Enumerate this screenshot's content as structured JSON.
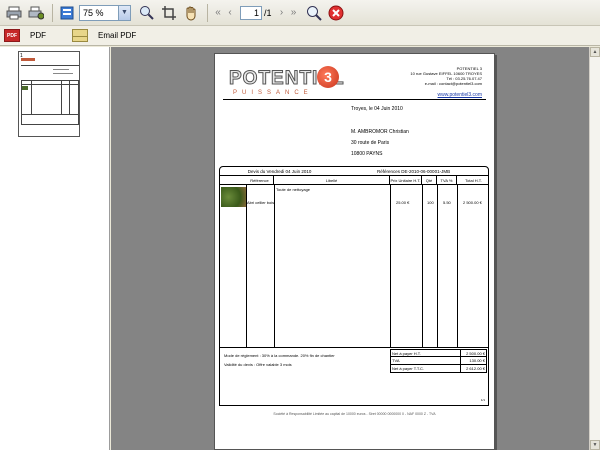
{
  "toolbar": {
    "zoom_value": "75 %",
    "page_current": "1",
    "page_total": "/1"
  },
  "toolbar2": {
    "pdf_label": "PDF",
    "pdf_icon_text": "PDF",
    "email_pdf_label": "Email PDF"
  },
  "thumbnail": {
    "page_number": "1"
  },
  "document": {
    "logo_text": "POTENTIEL",
    "logo_digit": "3",
    "logo_sub": "PUISSANCE",
    "company_lines": [
      "POTENTIEL 3",
      "10 rue Gustave EIFFEL   10600 TROYES",
      "Tél : 03.25.76.07.47",
      "e-mail : contact@potentiel3.com"
    ],
    "website": "www.potentiel3.com",
    "place_date": "Troyes, le 04 Juin 2010",
    "recipient": {
      "name": "M. AMBROMOR Christian",
      "street": "30 route de Paris",
      "city": "10800  PAYNS"
    },
    "quote_title": "Devis du Vendredi 04 Juin 2010",
    "quote_ref": "Références DE-2010-06-00001-JMB",
    "columns": [
      "Référence",
      "Libellé",
      "Prix Unitaire H.T.",
      "Qté",
      "TVA %",
      "Total H.T."
    ],
    "rows": [
      {
        "reference": "Abri cellier bois",
        "label": "Toute de nettoyage",
        "unit_price": "25.00 €",
        "qty": "100",
        "vat": "5.50",
        "total": "2 500.00 €"
      }
    ],
    "conditions": [
      "Mode de règlement : 30% à la commande. 20% fin de chantier",
      "Validité du devis : Offre valable 3 mois"
    ],
    "totals": [
      {
        "label": "Net à payer H.T.",
        "value": "2 500.00 €"
      },
      {
        "label": "TVA",
        "value": "130.00 €"
      },
      {
        "label": "Net à payer T.T.C.",
        "value": "2 612.00 €"
      }
    ],
    "page_no": "1/1",
    "bottom_note": "Société à Responsabilité Limitée au capital de 10000 euros  -  Siret 00000 0000000 0  -  NAF 0000 Z  -  TVA"
  }
}
